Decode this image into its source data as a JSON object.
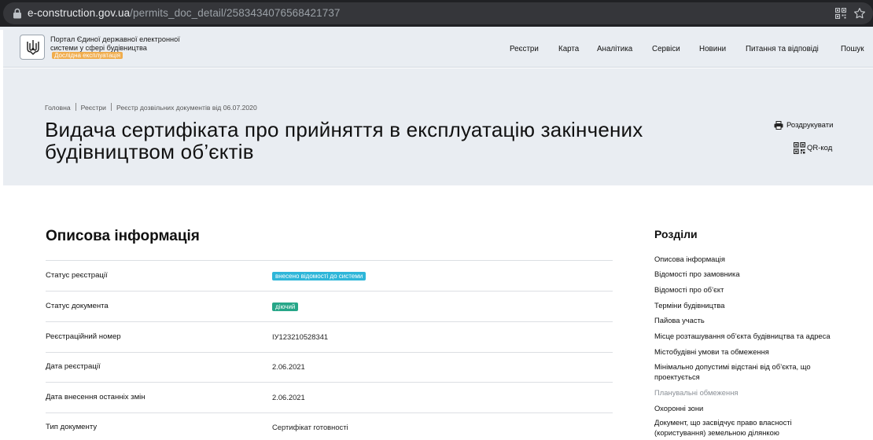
{
  "browser": {
    "url_host": "e-construction.gov.ua",
    "url_path": "/permits_doc_detail/2583434076568421737"
  },
  "header": {
    "portal_name": "Портал Єдиної державної електронної системи у сфері будівництва",
    "beta_badge": "Дослідна експлуатація",
    "nav": [
      "Реєстри",
      "Карта",
      "Аналітика",
      "Сервіси",
      "Новини",
      "Питання та відповіді",
      "Пошук"
    ]
  },
  "breadcrumb": [
    "Головна",
    "Реєстри",
    "Реєстр дозвільних документів від 06.07.2020"
  ],
  "page_title": "Видача сертифіката про прийняття в експлуатацію закінчених будівництвом об’єктів",
  "actions": {
    "print": "Роздрукувати",
    "qr": "QR-код"
  },
  "info": {
    "title": "Описова інформація",
    "rows": [
      {
        "label": "Статус реєстрації",
        "value": "внесено відомості до системи",
        "badge_color": "#2eb6d9"
      },
      {
        "label": "Статус документа",
        "value": "діючий",
        "badge_color": "#26a688"
      },
      {
        "label": "Реєстраційний номер",
        "value": "ІУ123210528341"
      },
      {
        "label": "Дата реєстрації",
        "value": "2.06.2021"
      },
      {
        "label": "Дата внесення останніх змін",
        "value": "2.06.2021"
      },
      {
        "label": "Тип документу",
        "value": "Сертифікат готовності"
      }
    ]
  },
  "sections": {
    "title": "Розділи",
    "items": [
      {
        "label": "Описова інформація",
        "muted": false
      },
      {
        "label": "Відомості про замовника",
        "muted": false
      },
      {
        "label": "Відомості про об’єкт",
        "muted": false
      },
      {
        "label": "Терміни будівництва",
        "muted": false
      },
      {
        "label": "Пайова участь",
        "muted": false
      },
      {
        "label": "Місце розташування об’єкта будівництва та адреса",
        "muted": false
      },
      {
        "label": "Містобудівні умови та обмеження",
        "muted": false
      },
      {
        "label": "Мінімально допустимі відстані від об’єкта, що проектується",
        "muted": false
      },
      {
        "label": "Планувальні обмеження",
        "muted": true
      },
      {
        "label": "Охоронні зони",
        "muted": false
      },
      {
        "label": "Документ, що засвідчує право власності (користування) земельною ділянкою",
        "muted": false
      }
    ]
  }
}
